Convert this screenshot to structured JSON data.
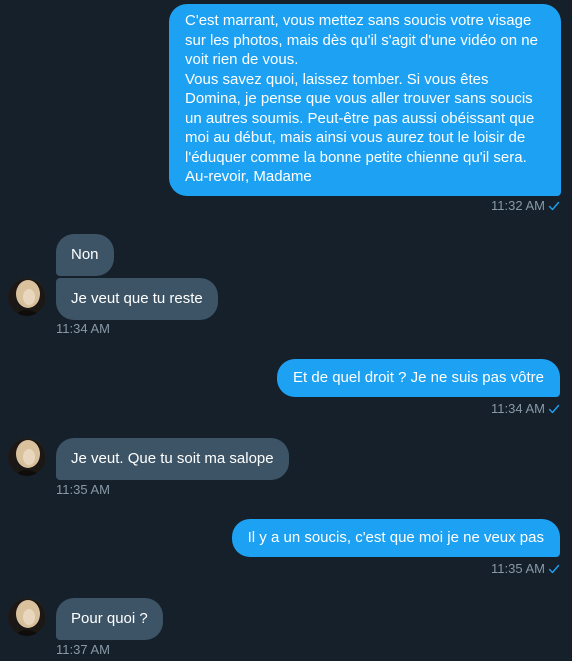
{
  "conversation": {
    "messages": [
      {
        "direction": "sent",
        "text": "C'est marrant, vous mettez sans soucis votre visage sur les photos, mais dès qu'il s'agit d'une vidéo on ne voit rien de vous.\nVous savez quoi, laissez tomber. Si vous êtes Domina, je pense que vous aller trouver sans soucis un autres soumis. Peut-être pas aussi obéissant que moi au début, mais ainsi vous aurez tout le loisir de l'éduquer comme la bonne petite chienne qu'il sera.\nAu-revoir, Madame",
        "time": "11:32 AM"
      },
      {
        "direction": "received",
        "text": "Non"
      },
      {
        "direction": "received",
        "text": "Je veut que tu reste",
        "time": "11:34 AM"
      },
      {
        "direction": "sent",
        "text": "Et de quel droit ? Je ne suis pas vôtre",
        "time": "11:34 AM"
      },
      {
        "direction": "received",
        "text": "Je veut. Que tu soit ma salope",
        "time": "11:35 AM"
      },
      {
        "direction": "sent",
        "text": "Il y a un soucis, c'est que moi je ne veux pas",
        "time": "11:35 AM"
      },
      {
        "direction": "received",
        "text": "Pour quoi ?",
        "time": "11:37 AM"
      }
    ]
  },
  "colors": {
    "background": "#15202b",
    "sent_bubble": "#1da1f2",
    "received_bubble": "#3d5466",
    "timestamp": "#8899a6",
    "read_check": "#1da1f2"
  },
  "icons": {
    "read_receipt": "check-icon",
    "contact_avatar": "avatar"
  }
}
